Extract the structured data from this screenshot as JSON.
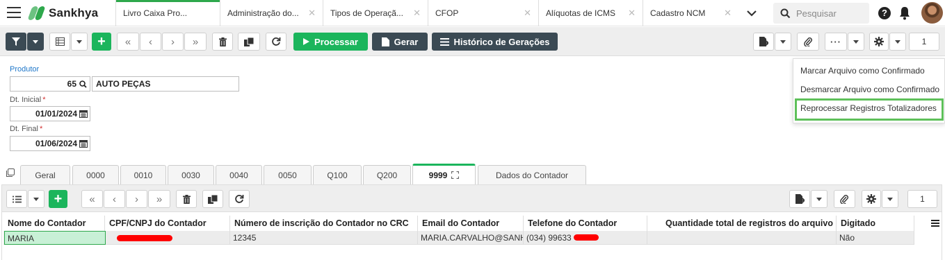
{
  "brand": {
    "name": "Sankhya",
    "color": "#2ea84c"
  },
  "tabs": [
    {
      "label": "Livro Caixa Pro...",
      "active": true
    },
    {
      "label": "Administração do..."
    },
    {
      "label": "Tipos de Operaçã..."
    },
    {
      "label": "CFOP"
    },
    {
      "label": "Alíquotas de ICMS"
    },
    {
      "label": "Cadastro NCM"
    }
  ],
  "search": {
    "placeholder": "Pesquisar"
  },
  "toolbar": {
    "processar_label": "Processar",
    "gerar_label": "Gerar",
    "historico_label": "Histórico de Gerações",
    "page_value": "1"
  },
  "form": {
    "produtor_label": "Produtor",
    "produtor_code": "65",
    "produtor_name": "AUTO PEÇAS",
    "dt_inicial_label": "Dt. Inicial",
    "dt_inicial_value": "01/01/2024",
    "dt_final_label": "Dt. Final",
    "dt_final_value": "01/06/2024",
    "required_mark": "*"
  },
  "menu": {
    "items": [
      "Marcar Arquivo como Confirmado",
      "Desmarcar Arquivo como Confirmado",
      "Reprocessar Registros Totalizadores"
    ]
  },
  "detail_tabs": [
    "Geral",
    "0000",
    "0010",
    "0030",
    "0040",
    "0050",
    "Q100",
    "Q200",
    "9999",
    "Dados do Contador"
  ],
  "detail_toolbar": {
    "page_value": "1"
  },
  "grid": {
    "headers": [
      "Nome do Contador",
      "CPF/CNPJ do Contador",
      "Número de inscrição do Contador no CRC",
      "Email do Contador",
      "Telefone do Contador",
      "Quantidade total de registros do arquivo",
      "Digitado"
    ],
    "row": {
      "nome": "MARIA",
      "crc": "12345",
      "email": "MARIA.CARVALHO@SANH",
      "telefone": "(034) 99633",
      "digitado": "Não"
    }
  },
  "colors": {
    "accent_green": "#1bb55c",
    "dark_button": "#3b4a54",
    "link_blue": "#1f77c9",
    "required_red": "#d32f2f"
  }
}
